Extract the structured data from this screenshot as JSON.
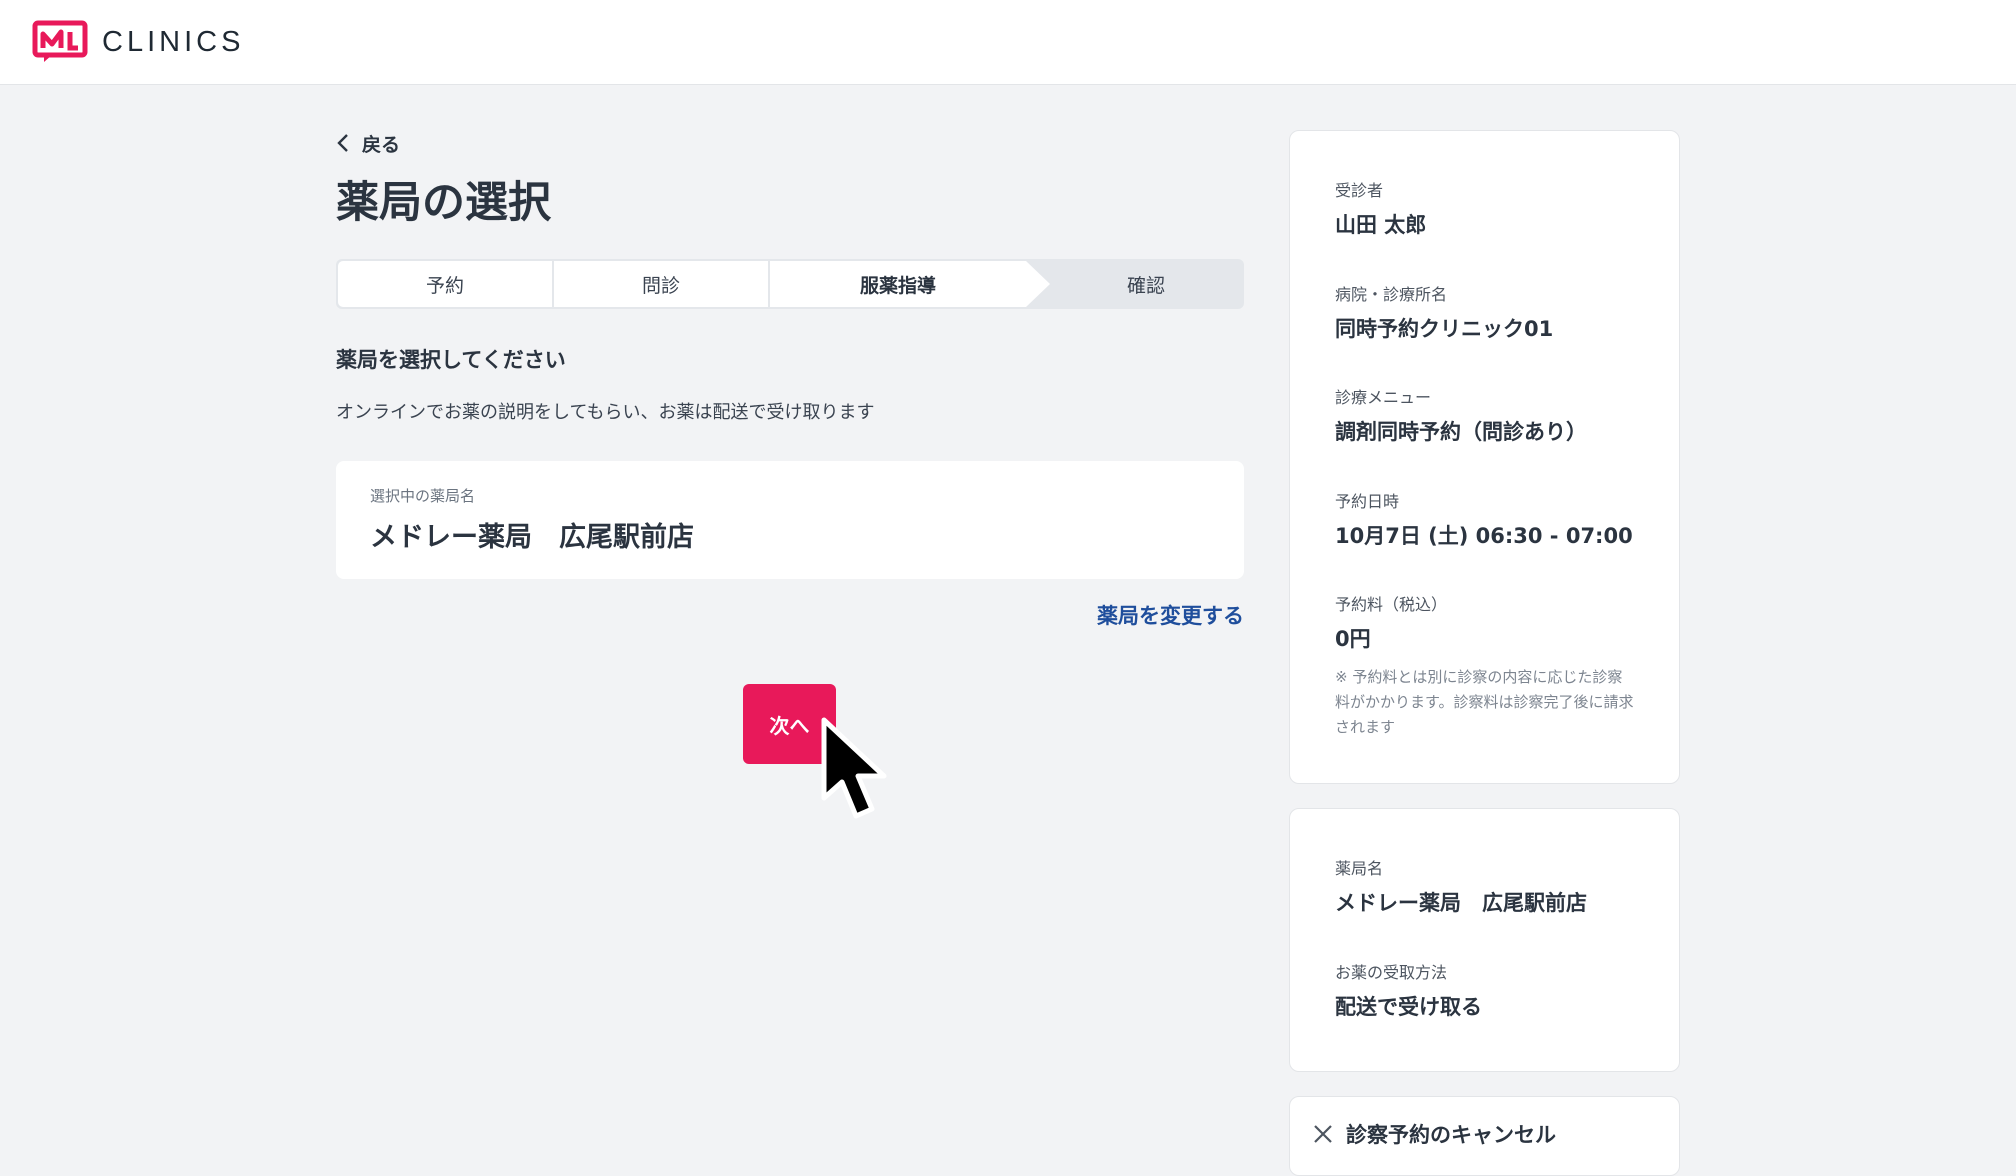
{
  "header": {
    "brand": "CLINICS",
    "brand_color": "#e8195a"
  },
  "main": {
    "back_label": "戻る",
    "title": "薬局の選択",
    "steps": [
      {
        "label": "予約",
        "state": "done"
      },
      {
        "label": "問診",
        "state": "done"
      },
      {
        "label": "服薬指導",
        "state": "current"
      },
      {
        "label": "確認",
        "state": "pending"
      }
    ],
    "section_title": "薬局を選択してください",
    "section_desc": "オンラインでお薬の説明をしてもらい、お薬は配送で受け取ります",
    "selected_label": "選択中の薬局名",
    "selected_value": "メドレー薬局　広尾駅前店",
    "change_link": "薬局を変更する",
    "next_button": "次へ"
  },
  "summary": {
    "patient_label": "受診者",
    "patient_value": "山田 太郎",
    "clinic_label": "病院・診療所名",
    "clinic_value": "同時予約クリニック01",
    "menu_label": "診療メニュー",
    "menu_value": "調剤同時予約（問診あり）",
    "datetime_label": "予約日時",
    "datetime_value": "10月7日 (土) 06:30 - 07:00",
    "fee_label": "予約料（税込）",
    "fee_value": "0円",
    "fee_note": "※ 予約料とは別に診察の内容に応じた診察料がかかります。診察料は診察完了後に請求されます"
  },
  "pharmacy_summary": {
    "name_label": "薬局名",
    "name_value": "メドレー薬局　広尾駅前店",
    "method_label": "お薬の受取方法",
    "method_value": "配送で受け取る"
  },
  "cancel": {
    "label": "診察予約のキャンセル"
  }
}
